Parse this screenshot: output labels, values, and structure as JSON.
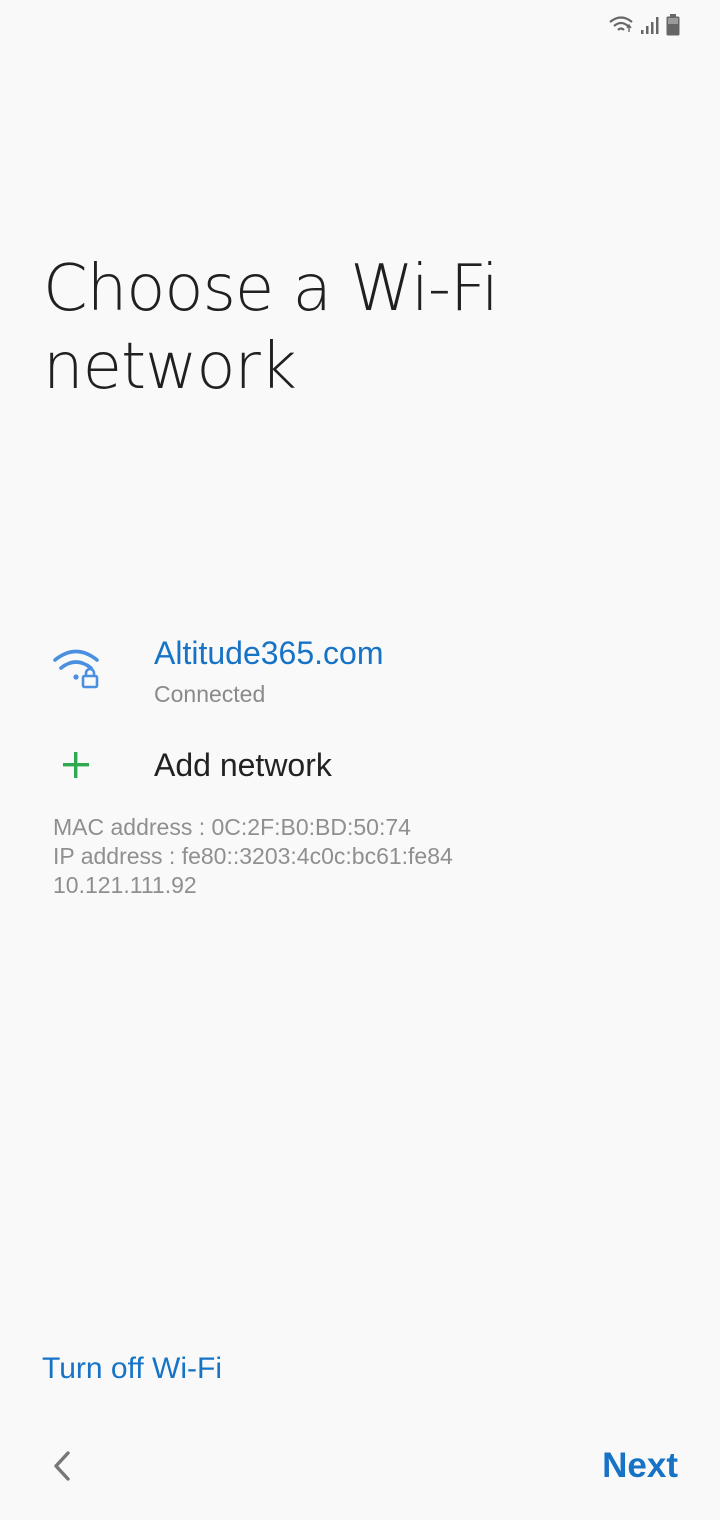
{
  "status_bar": {
    "icons": [
      "wifi-icon",
      "signal-icon",
      "battery-icon"
    ]
  },
  "page": {
    "title": "Choose a Wi‑Fi network"
  },
  "networks": [
    {
      "name": "Altitude365.com",
      "status": "Connected",
      "icon": "wifi-lock-icon"
    }
  ],
  "add_network": {
    "label": "Add network",
    "icon": "plus-icon"
  },
  "device_info": {
    "mac": "MAC address : 0C:2F:B0:BD:50:74",
    "ip": "IP address : fe80::3203:4c0c:bc61:fe84",
    "ip2": "10.121.111.92"
  },
  "footer": {
    "turn_off_label": "Turn off Wi-Fi",
    "next_label": "Next",
    "back_icon": "chevron-left-icon"
  },
  "colors": {
    "accent": "#1673c5",
    "wifi_icon": "#4a8fe0",
    "plus_icon": "#2fa84f",
    "background": "#f9f9f9"
  }
}
